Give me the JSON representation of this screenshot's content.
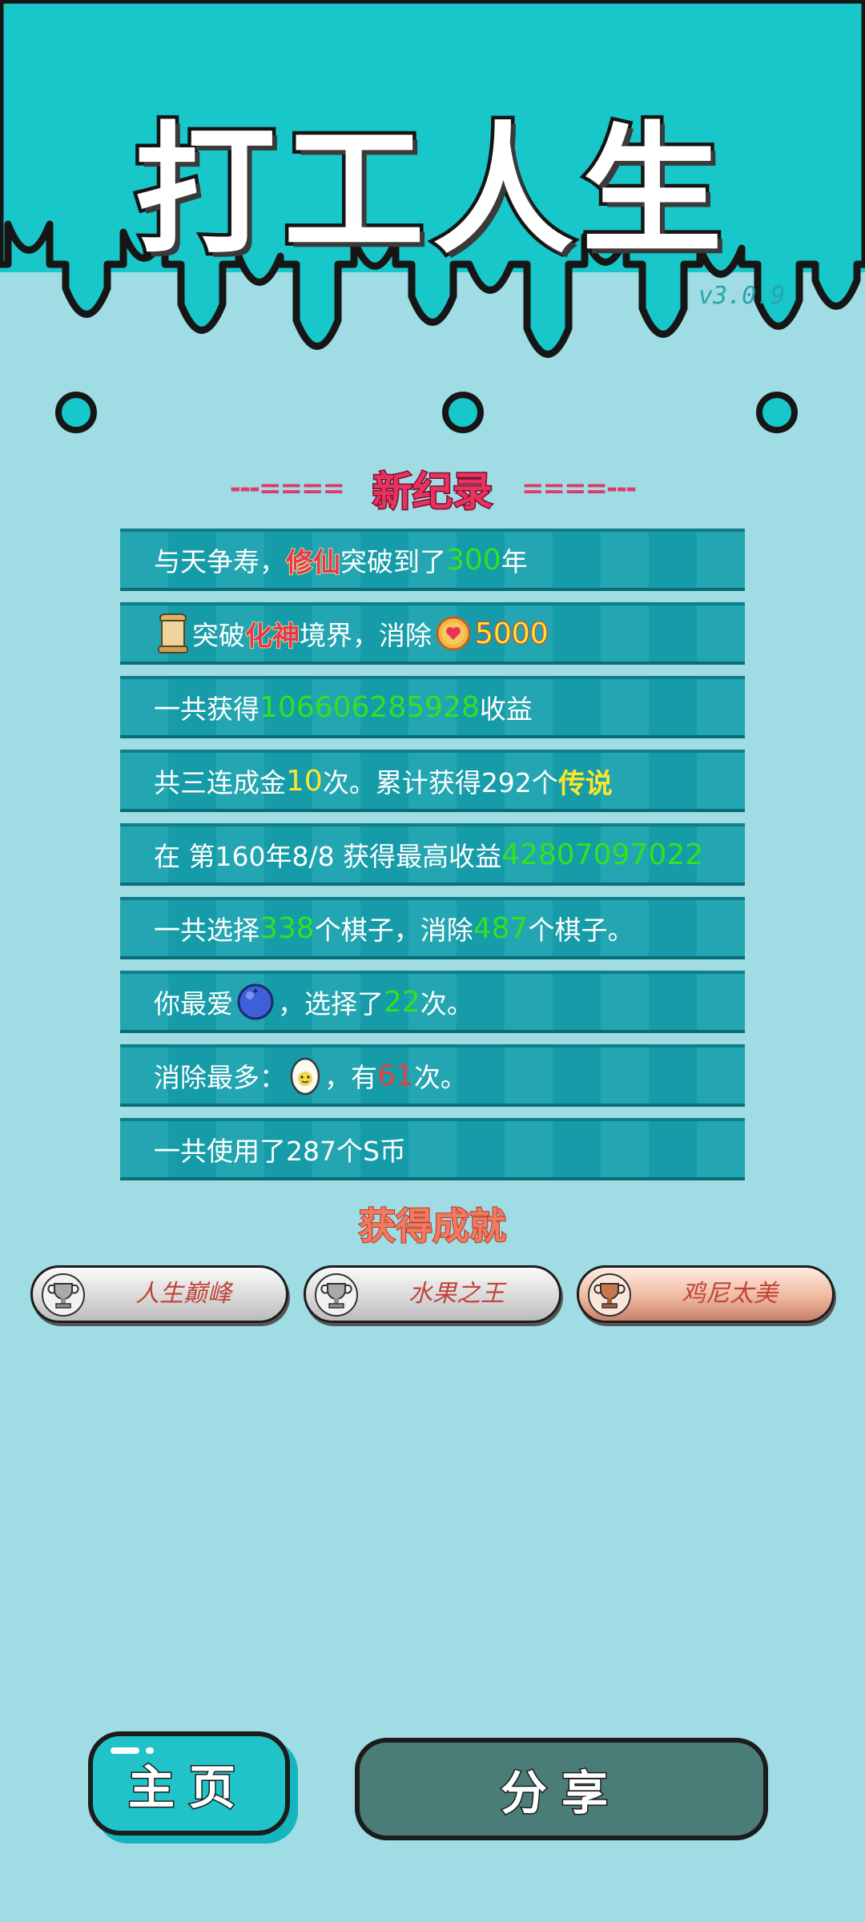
{
  "app": {
    "title": "打工人生",
    "version": "v3.0.9"
  },
  "record": {
    "dash_left": "---====",
    "title": "新纪录",
    "dash_right": "====---"
  },
  "stats": {
    "row1": {
      "pre": "与天争寿，",
      "tag": "修仙",
      "mid": "突破到了",
      "value": "300",
      "post": "年"
    },
    "row2": {
      "pre": "突破",
      "tag": "化神",
      "mid": "境界，消除",
      "value": "5000",
      "icon_left": "scroll-icon",
      "icon_coin": "heart-coin-icon"
    },
    "row3": {
      "pre": "一共获得",
      "value": "106606285928",
      "post": "收益"
    },
    "row4": {
      "pre": "共三连成金",
      "value": "10",
      "mid": "次。累计获得292个",
      "tag": "传说"
    },
    "row5": {
      "pre": "在 第160年8/8 获得最高收益",
      "value": "42807097022"
    },
    "row6": {
      "pre": "一共选择",
      "value1": "338",
      "mid": "个棋子，消除",
      "value2": "487",
      "post": "个棋子。"
    },
    "row7": {
      "pre": "你最爱",
      "mid": "，选择了",
      "value": "22",
      "post": "次。",
      "icon": "blueberry-icon"
    },
    "row8": {
      "pre": "消除最多：",
      "mid": "，有",
      "value": "61",
      "post": "次。",
      "icon": "egg-icon"
    },
    "row9": {
      "text": "一共使用了287个S币"
    }
  },
  "achievements": {
    "title": "获得成就",
    "items": [
      {
        "label": "人生巅峰",
        "tier": "silver"
      },
      {
        "label": "水果之王",
        "tier": "silver"
      },
      {
        "label": "鸡尼太美",
        "tier": "bronze"
      }
    ]
  },
  "buttons": {
    "home": "主页",
    "share": "分享"
  },
  "colors": {
    "background": "#9fdce4",
    "band": "#17c7c9",
    "row": "#17a1ae",
    "highlight_green": "#2fe31e",
    "highlight_yellow": "#fbe62a"
  }
}
